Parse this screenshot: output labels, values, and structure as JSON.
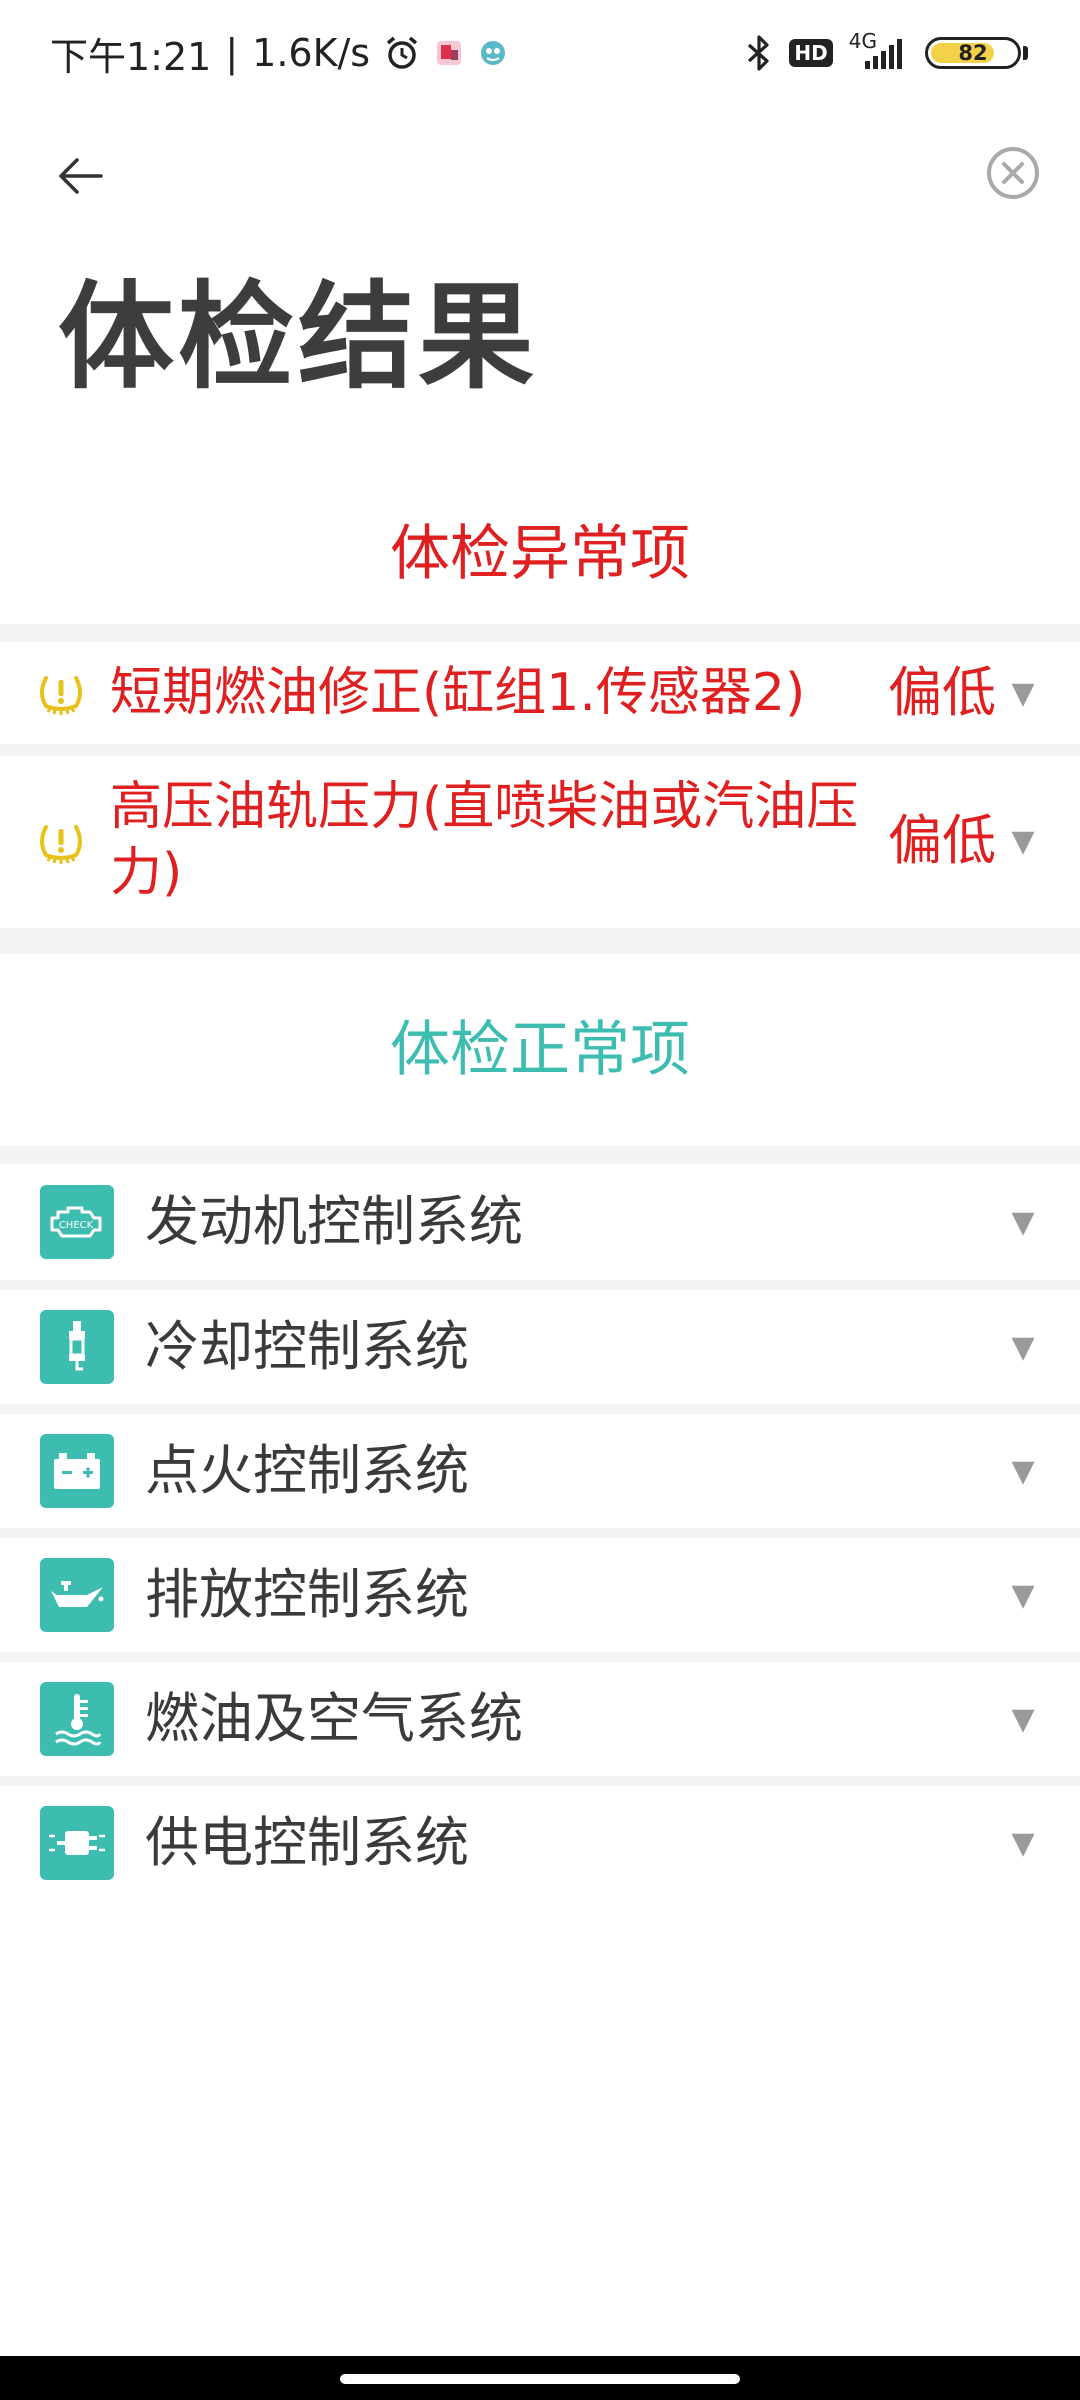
{
  "status_bar": {
    "time": "下午1:21",
    "network_speed": "1.6K/s",
    "hd_label": "HD",
    "network_type": "4G",
    "battery_level": "82"
  },
  "header": {
    "title": "体检结果"
  },
  "abnormal": {
    "heading": "体检异常项",
    "items": [
      {
        "label": "短期燃油修正(缸组1.传感器2)",
        "value": "偏低"
      },
      {
        "label": "高压油轨压力(直喷柴油或汽油压力)",
        "value": "偏低"
      }
    ]
  },
  "normal": {
    "heading": "体检正常项",
    "items": [
      {
        "label": "发动机控制系统",
        "icon": "check-engine-icon"
      },
      {
        "label": "冷却控制系统",
        "icon": "spark-plug-icon"
      },
      {
        "label": "点火控制系统",
        "icon": "battery-icon"
      },
      {
        "label": "排放控制系统",
        "icon": "oil-can-icon"
      },
      {
        "label": "燃油及空气系统",
        "icon": "coolant-temperature-icon"
      },
      {
        "label": "供电控制系统",
        "icon": "plug-icon"
      }
    ]
  },
  "colors": {
    "abnormal": "#e02020",
    "normal": "#3dbdb0",
    "warning_icon": "#e8c21a"
  }
}
